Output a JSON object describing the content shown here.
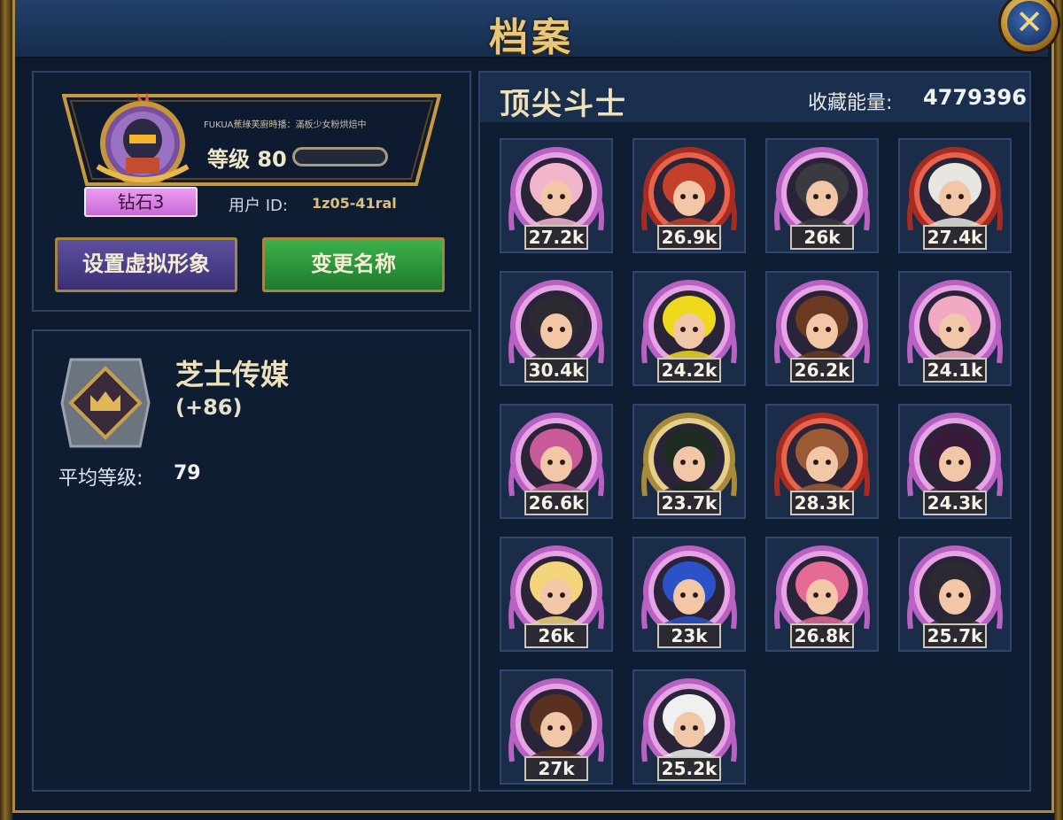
{
  "window": {
    "title": "档案",
    "close_label": "✕"
  },
  "profile": {
    "motto": "FUKUA蕉綠芙廚時播：滿板少女粉烘焙中",
    "level_label": "等级 80",
    "rank": "钻石3",
    "uid_label": "用户 ID:",
    "uid_value": "1z05-41ral",
    "set_avatar_label": "设置虚拟形象",
    "rename_label": "变更名称"
  },
  "team": {
    "name": "芝士传媒",
    "delta": "(+86)",
    "avg_label": "平均等级:",
    "avg_value": "79"
  },
  "top_fighters": {
    "title": "顶尖斗士",
    "collection_label": "收藏能量:",
    "collection_value": "4779396",
    "fighters": [
      {
        "score": "27.2k",
        "ring": "pink",
        "hair": "#f2b6cc"
      },
      {
        "score": "26.9k",
        "ring": "red",
        "hair": "#c4402a"
      },
      {
        "score": "26k",
        "ring": "pink",
        "hair": "#3a3a40"
      },
      {
        "score": "27.4k",
        "ring": "red",
        "hair": "#e8e6e0"
      },
      {
        "score": "30.4k",
        "ring": "pink",
        "hair": "#2c2a30"
      },
      {
        "score": "24.2k",
        "ring": "pink",
        "hair": "#f0d81c"
      },
      {
        "score": "26.2k",
        "ring": "pink",
        "hair": "#6a3a22"
      },
      {
        "score": "24.1k",
        "ring": "pink",
        "hair": "#f2aac4"
      },
      {
        "score": "26.6k",
        "ring": "pink",
        "hair": "#c85a9a"
      },
      {
        "score": "23.7k",
        "ring": "gold",
        "hair": "#1e2c22"
      },
      {
        "score": "28.3k",
        "ring": "red",
        "hair": "#9a5a36"
      },
      {
        "score": "24.3k",
        "ring": "pink",
        "hair": "#3a1a3a"
      },
      {
        "score": "26k",
        "ring": "pink",
        "hair": "#f4d47a"
      },
      {
        "score": "23k",
        "ring": "pink",
        "hair": "#2c52c8"
      },
      {
        "score": "26.8k",
        "ring": "pink",
        "hair": "#e56a94"
      },
      {
        "score": "25.7k",
        "ring": "pink",
        "hair": "#2a2a30"
      },
      {
        "score": "27k",
        "ring": "pink",
        "hair": "#5a3020"
      },
      {
        "score": "25.2k",
        "ring": "pink",
        "hair": "#f0f0f0"
      }
    ]
  },
  "colors": {
    "gold_border": "#b08a3a",
    "panel_bg": "#0f1d33",
    "rank_pink": "#e090ea",
    "button_purple": "#4a3f8a",
    "button_green": "#2e9a3c"
  }
}
